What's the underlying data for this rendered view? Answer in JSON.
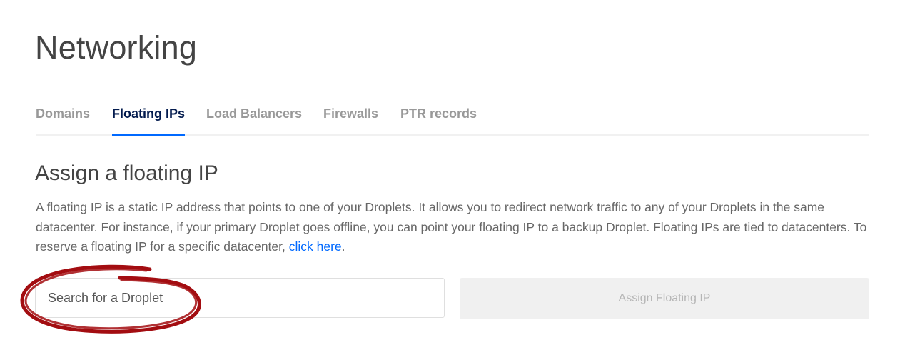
{
  "page": {
    "title": "Networking"
  },
  "tabs": [
    {
      "label": "Domains",
      "active": false
    },
    {
      "label": "Floating IPs",
      "active": true
    },
    {
      "label": "Load Balancers",
      "active": false
    },
    {
      "label": "Firewalls",
      "active": false
    },
    {
      "label": "PTR records",
      "active": false
    }
  ],
  "section": {
    "heading": "Assign a floating IP",
    "description": "A floating IP is a static IP address that points to one of your Droplets. It allows you to redirect network traffic to any of your Droplets in the same datacenter. For instance, if your primary Droplet goes offline, you can point your floating IP to a backup Droplet. Floating IPs are tied to datacenters. To reserve a floating IP for a specific datacenter, ",
    "link_label": "click here",
    "description_end": "."
  },
  "form": {
    "search_placeholder": "Search for a Droplet",
    "search_value": "",
    "assign_button_label": "Assign Floating IP",
    "assign_button_disabled": true
  },
  "colors": {
    "accent": "#0069ff",
    "active_tab_text": "#031b4e",
    "annotation_red": "#a30d11"
  }
}
